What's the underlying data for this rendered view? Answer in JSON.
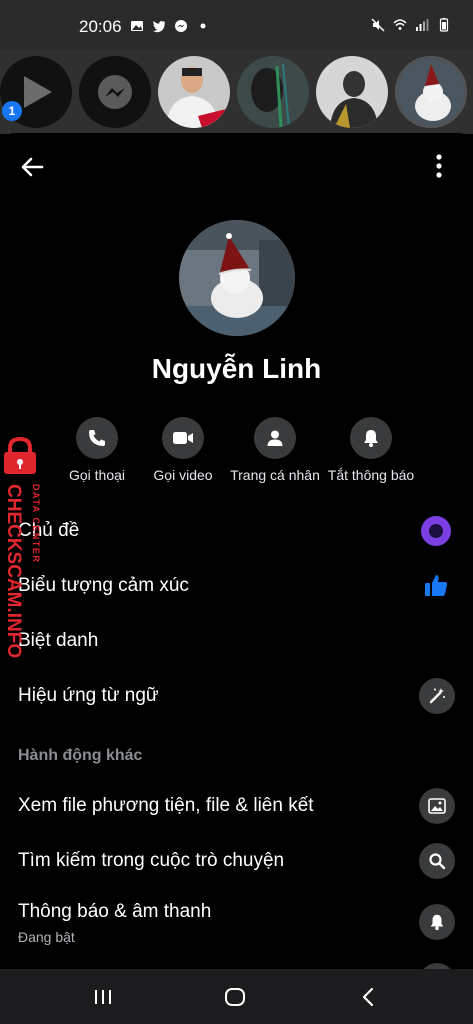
{
  "status_bar": {
    "time": "20:06"
  },
  "bubbles": {
    "badge_count": "1"
  },
  "profile": {
    "name": "Nguyễn Linh"
  },
  "actions": [
    {
      "label": "Gọi thoại",
      "icon": "phone-icon"
    },
    {
      "label": "Gọi video",
      "icon": "video-camera-icon"
    },
    {
      "label": "Trang cá nhân",
      "icon": "person-icon"
    },
    {
      "label": "Tắt thông báo",
      "icon": "bell-icon"
    }
  ],
  "menu": {
    "theme": "Chủ đề",
    "emoji": "Biểu tượng cảm xúc",
    "nickname": "Biệt danh",
    "word_effects": "Hiệu ứng từ ngữ",
    "more_actions_title": "Hành động khác",
    "media": "Xem file phương tiện, file & liên kết",
    "search": "Tìm kiếm trong cuộc trò chuyện",
    "notifications": "Thông báo & âm thanh",
    "notifications_status": "Đang bật"
  },
  "watermark": {
    "brand": "CHECKSCAM.INFO",
    "tag": "DATA CENTER"
  },
  "colors": {
    "accent_blue": "#1877f2",
    "theme_purple": "#7b3fe4",
    "icon_circle_bg": "#3a3b3c"
  }
}
